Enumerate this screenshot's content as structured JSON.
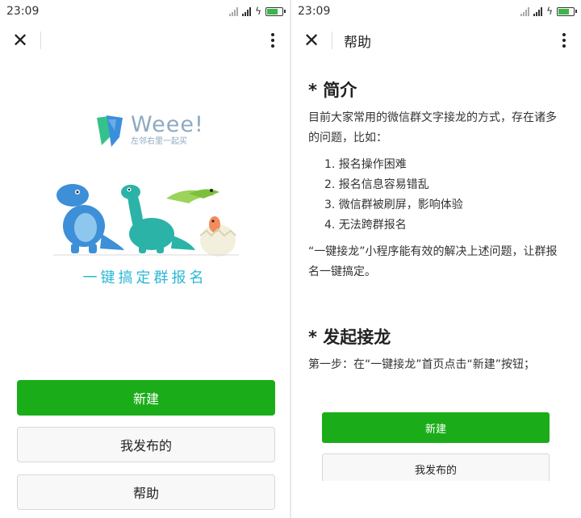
{
  "left": {
    "status": {
      "time": "23:09"
    },
    "nav": {
      "close_glyph": "✕",
      "more_label": "more-menu"
    },
    "brand": {
      "word": "Weee!",
      "sub": "左邻右里一起买",
      "colors": {
        "left_leaf": "#34c28b",
        "right_leaf": "#3a8fdc"
      }
    },
    "slogan": "一键搞定群报名",
    "buttons": {
      "new": "新建",
      "published": "我发布的",
      "help": "帮助"
    }
  },
  "right": {
    "status": {
      "time": "23:09"
    },
    "nav": {
      "close_glyph": "✕",
      "title": "帮助"
    },
    "intro": {
      "heading": "* 简介",
      "para": "目前大家常用的微信群文字接龙的方式，存在诸多的问题，比如：",
      "items": [
        "1. 报名操作困难",
        "2. 报名信息容易错乱",
        "3. 微信群被刷屏，影响体验",
        "4. 无法跨群报名"
      ],
      "para2": "“一键接龙”小程序能有效的解决上述问题，让群报名一键搞定。"
    },
    "start": {
      "heading": "* 发起接龙",
      "step1": "第一步：在“一键接龙”首页点击“新建”按钮；"
    },
    "preview": {
      "new": "新建",
      "published": "我发布的"
    }
  },
  "colors": {
    "accent": "#1aad19",
    "slogan": "#2bb7d6"
  }
}
